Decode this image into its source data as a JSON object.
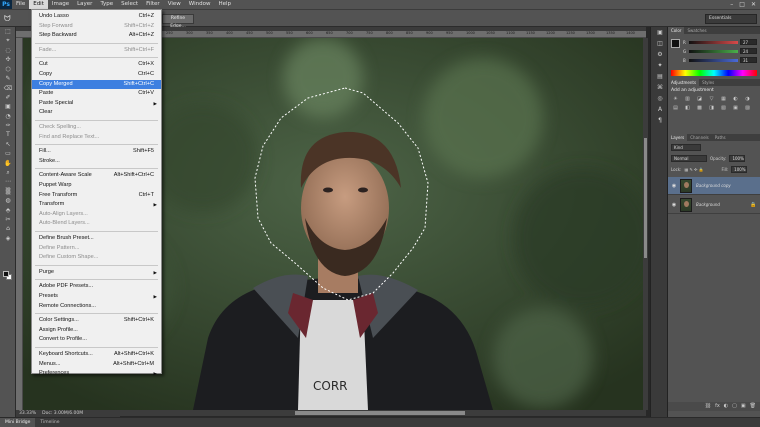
{
  "app": {
    "logo": "Ps"
  },
  "menubar": {
    "items": [
      "File",
      "Edit",
      "Image",
      "Layer",
      "Type",
      "Select",
      "Filter",
      "View",
      "Window",
      "Help"
    ],
    "active": "Edit",
    "window_controls": [
      "–",
      "□",
      "✕"
    ]
  },
  "options_bar": {
    "refine_button": "Refine Edge...",
    "workspace": "Essentials"
  },
  "ruler_ticks": [
    "250",
    "300",
    "350",
    "400",
    "450",
    "500",
    "550",
    "600",
    "650",
    "700",
    "750",
    "800",
    "850",
    "900",
    "950",
    "1000",
    "1050",
    "1100",
    "1150",
    "1200",
    "1250",
    "1300",
    "1350",
    "1400"
  ],
  "status": {
    "zoom": "33.33%",
    "doc": "Doc: 3.00M/6.00M"
  },
  "bottom_tabs": [
    "Mini Bridge",
    "Timeline"
  ],
  "color_panel": {
    "tabs": [
      "Color",
      "Swatches"
    ],
    "channels": [
      {
        "label": "R",
        "value": "27",
        "color": "#d84a4a"
      },
      {
        "label": "G",
        "value": "24",
        "color": "#4ab04a"
      },
      {
        "label": "B",
        "value": "31",
        "color": "#4a6ad8"
      }
    ]
  },
  "adjustments_panel": {
    "tabs": [
      "Adjustments",
      "Styles"
    ],
    "title": "Add an adjustment",
    "icons": [
      "☀",
      "▥",
      "◪",
      "▽",
      "▦",
      "◐",
      "◑",
      "▤",
      "◧",
      "▩",
      "◨",
      "▧",
      "▣",
      "▨"
    ]
  },
  "layers_panel": {
    "tabs": [
      "Layers",
      "Channels",
      "Paths"
    ],
    "kind": "Kind",
    "blend_mode": "Normal",
    "opacity_label": "Opacity:",
    "opacity": "100%",
    "lock_label": "Lock:",
    "fill_label": "Fill:",
    "fill": "100%",
    "layers": [
      {
        "name": "Background copy",
        "selected": true
      },
      {
        "name": "Background",
        "selected": false
      }
    ],
    "footer_icons": [
      "⛓",
      "fx",
      "◐",
      "▢",
      "▣",
      "🗑"
    ]
  },
  "edit_menu": {
    "items": [
      {
        "label": "Undo Lasso",
        "shortcut": "Ctrl+Z",
        "state": "normal"
      },
      {
        "label": "Step Forward",
        "shortcut": "Shift+Ctrl+Z",
        "state": "disabled"
      },
      {
        "label": "Step Backward",
        "shortcut": "Alt+Ctrl+Z",
        "state": "normal"
      },
      {
        "sep": true
      },
      {
        "label": "Fade...",
        "shortcut": "Shift+Ctrl+F",
        "state": "disabled"
      },
      {
        "sep": true
      },
      {
        "label": "Cut",
        "shortcut": "Ctrl+X",
        "state": "normal"
      },
      {
        "label": "Copy",
        "shortcut": "Ctrl+C",
        "state": "normal"
      },
      {
        "label": "Copy Merged",
        "shortcut": "Shift+Ctrl+C",
        "state": "highlighted"
      },
      {
        "label": "Paste",
        "shortcut": "Ctrl+V",
        "state": "normal"
      },
      {
        "label": "Paste Special",
        "shortcut": "",
        "state": "normal",
        "submenu": true
      },
      {
        "label": "Clear",
        "shortcut": "",
        "state": "normal"
      },
      {
        "sep": true
      },
      {
        "label": "Check Spelling...",
        "shortcut": "",
        "state": "disabled"
      },
      {
        "label": "Find and Replace Text...",
        "shortcut": "",
        "state": "disabled"
      },
      {
        "sep": true
      },
      {
        "label": "Fill...",
        "shortcut": "Shift+F5",
        "state": "normal"
      },
      {
        "label": "Stroke...",
        "shortcut": "",
        "state": "normal"
      },
      {
        "sep": true
      },
      {
        "label": "Content-Aware Scale",
        "shortcut": "Alt+Shift+Ctrl+C",
        "state": "normal"
      },
      {
        "label": "Puppet Warp",
        "shortcut": "",
        "state": "normal"
      },
      {
        "label": "Free Transform",
        "shortcut": "Ctrl+T",
        "state": "normal"
      },
      {
        "label": "Transform",
        "shortcut": "",
        "state": "normal",
        "submenu": true
      },
      {
        "label": "Auto-Align Layers...",
        "shortcut": "",
        "state": "disabled"
      },
      {
        "label": "Auto-Blend Layers...",
        "shortcut": "",
        "state": "disabled"
      },
      {
        "sep": true
      },
      {
        "label": "Define Brush Preset...",
        "shortcut": "",
        "state": "normal"
      },
      {
        "label": "Define Pattern...",
        "shortcut": "",
        "state": "disabled"
      },
      {
        "label": "Define Custom Shape...",
        "shortcut": "",
        "state": "disabled"
      },
      {
        "sep": true
      },
      {
        "label": "Purge",
        "shortcut": "",
        "state": "normal",
        "submenu": true
      },
      {
        "sep": true
      },
      {
        "label": "Adobe PDF Presets...",
        "shortcut": "",
        "state": "normal"
      },
      {
        "label": "Presets",
        "shortcut": "",
        "state": "normal",
        "submenu": true
      },
      {
        "label": "Remote Connections...",
        "shortcut": "",
        "state": "normal"
      },
      {
        "sep": true
      },
      {
        "label": "Color Settings...",
        "shortcut": "Shift+Ctrl+K",
        "state": "normal"
      },
      {
        "label": "Assign Profile...",
        "shortcut": "",
        "state": "normal"
      },
      {
        "label": "Convert to Profile...",
        "shortcut": "",
        "state": "normal"
      },
      {
        "sep": true
      },
      {
        "label": "Keyboard Shortcuts...",
        "shortcut": "Alt+Shift+Ctrl+K",
        "state": "normal"
      },
      {
        "label": "Menus...",
        "shortcut": "Alt+Shift+Ctrl+M",
        "state": "normal"
      },
      {
        "label": "Preferences",
        "shortcut": "",
        "state": "normal",
        "submenu": true
      }
    ]
  },
  "toolbar": {
    "tools": [
      "⬚",
      "⌖",
      "◌",
      "✣",
      "⬡",
      "✎",
      "⌫",
      "✐",
      "▣",
      "◔",
      "✑",
      "T",
      "↖",
      "▭",
      "✋",
      "⌕",
      "⋯",
      "▒",
      "◍",
      "⬘",
      "✂",
      "⌂",
      "◈"
    ]
  },
  "dock": {
    "icons": [
      "▣",
      "◫",
      "⚙",
      "✦",
      "▤",
      "⌘",
      "◎",
      "A",
      "¶"
    ]
  },
  "canvas": {
    "shirt_text": "CORR"
  }
}
